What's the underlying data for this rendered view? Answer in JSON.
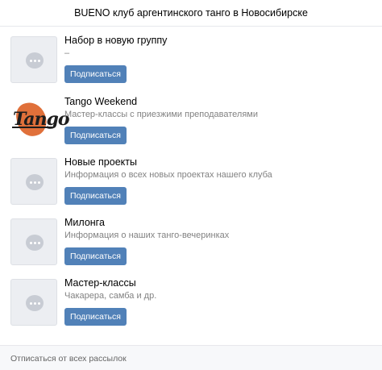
{
  "header": {
    "title": "BUENO клуб аргентинского танго в Новосибирске"
  },
  "items": [
    {
      "title": "Набор в новую группу",
      "description": "–",
      "button": "Подписаться",
      "icon": "chat-placeholder-icon"
    },
    {
      "title": "Tango Weekend",
      "description": "Мастер-классы с приезжими преподавателями",
      "button": "Подписаться",
      "icon": "tango-logo"
    },
    {
      "title": "Новые проекты",
      "description": "Информация о всех новых проектах нашего клуба",
      "button": "Подписаться",
      "icon": "chat-placeholder-icon"
    },
    {
      "title": "Милонга",
      "description": "Информация о наших танго-вечеринках",
      "button": "Подписаться",
      "icon": "chat-placeholder-icon"
    },
    {
      "title": "Мастер-классы",
      "description": "Чакарера, самба и др.",
      "button": "Подписаться",
      "icon": "chat-placeholder-icon"
    }
  ],
  "footer": {
    "unsubscribe_all": "Отписаться от всех рассылок"
  },
  "colors": {
    "button": "#5181b8",
    "footer_bg": "#f7f8fa"
  }
}
